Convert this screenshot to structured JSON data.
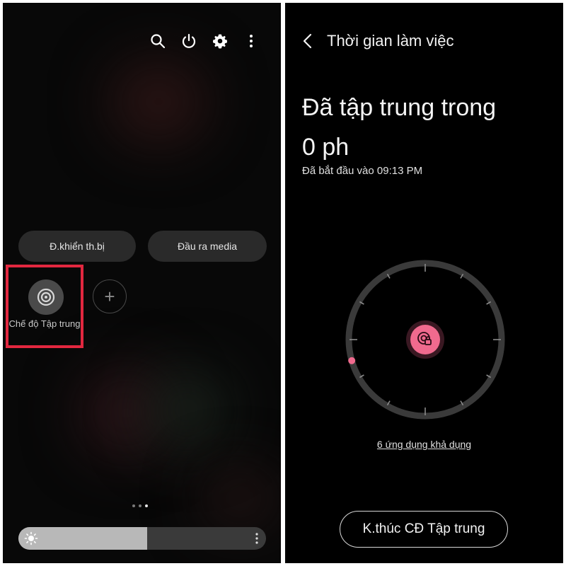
{
  "left_panel": {
    "top_icons": [
      "search-icon",
      "power-icon",
      "settings-icon",
      "more-vert-icon"
    ],
    "pills": {
      "device_control": "Đ.khiển th.bị",
      "media_output": "Đầu ra media"
    },
    "focus_tile": {
      "label": "Chế độ Tập trung",
      "icon": "focus-target-icon"
    },
    "add_tile_symbol": "+",
    "page_indicator": {
      "count": 3,
      "active_index": 2
    },
    "brightness": {
      "level": 0.52
    }
  },
  "right_panel": {
    "title": "Thời gian làm việc",
    "headline_line1": "Đã tập trung trong",
    "headline_line2": "0 ph",
    "started_at": "Đã bắt đầu vào 09:13 PM",
    "apps_link": "6 ứng dụng khả dụng",
    "end_button": "K.thúc CĐ Tập trung",
    "dial": {
      "progress_marker_angle_deg": 254
    }
  },
  "colors": {
    "accent_pink": "#f06a8e",
    "highlight_red": "#e2273f"
  }
}
